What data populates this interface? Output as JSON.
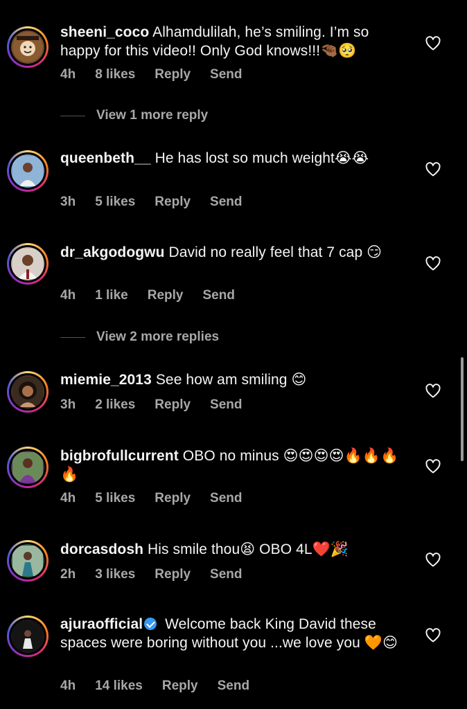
{
  "comments": [
    {
      "username": "sheeni_coco",
      "text": "Alhamdulilah, he’s smiling. I’m so happy for this video!! Only God knows!!!🤏🏾🥺",
      "time": "4h",
      "likes": "8 likes",
      "reply": "Reply",
      "send": "Send",
      "avatar_color": "#6b4a2b",
      "avatar_icon": "cartoon-avatar-icon"
    },
    {
      "username": "queenbeth__",
      "text": "He has lost so much weight😭😭",
      "time": "3h",
      "likes": "5 likes",
      "reply": "Reply",
      "send": "Send",
      "avatar_color": "#7aa0c8",
      "avatar_icon": "person-avatar-icon"
    },
    {
      "username": "dr_akgodogwu",
      "text": "David no really feel that 7 cap 😏",
      "time": "4h",
      "likes": "1 like",
      "reply": "Reply",
      "send": "Send",
      "avatar_color": "#c8b8a8",
      "avatar_icon": "person-avatar-icon"
    },
    {
      "username": "miemie_2013",
      "text": "See how am smiling 😊",
      "time": "3h",
      "likes": "2 likes",
      "reply": "Reply",
      "send": "Send",
      "avatar_color": "#4a3428",
      "avatar_icon": "person-avatar-icon"
    },
    {
      "username": "bigbrofullcurrent",
      "text": "OBO no minus 😍😍😍😍🔥🔥🔥🔥",
      "time": "4h",
      "likes": "5 likes",
      "reply": "Reply",
      "send": "Send",
      "avatar_color": "#5a2a6a",
      "avatar_icon": "person-avatar-icon"
    },
    {
      "username": "dorcasdosh",
      "text": "His smile thou😫 OBO 4L❤️🎉",
      "time": "2h",
      "likes": "3 likes",
      "reply": "Reply",
      "send": "Send",
      "avatar_color": "#3a5a4a",
      "avatar_icon": "person-avatar-icon"
    },
    {
      "username": "ajuraofficial",
      "text": "Welcome back King David these spaces were boring without you ...we love you 🧡😊",
      "time": "4h",
      "likes": "14 likes",
      "reply": "Reply",
      "send": "Send",
      "avatar_color": "#1a1a1a",
      "avatar_icon": "person-avatar-icon",
      "verified": true
    }
  ],
  "view_more": [
    {
      "label": "View 1 more reply"
    },
    {
      "label": "View 2 more replies"
    }
  ],
  "colors": {
    "background": "#000000",
    "text": "#f5f5f5",
    "secondary_text": "#a8a8a8",
    "verified_badge": "#3897f0"
  }
}
